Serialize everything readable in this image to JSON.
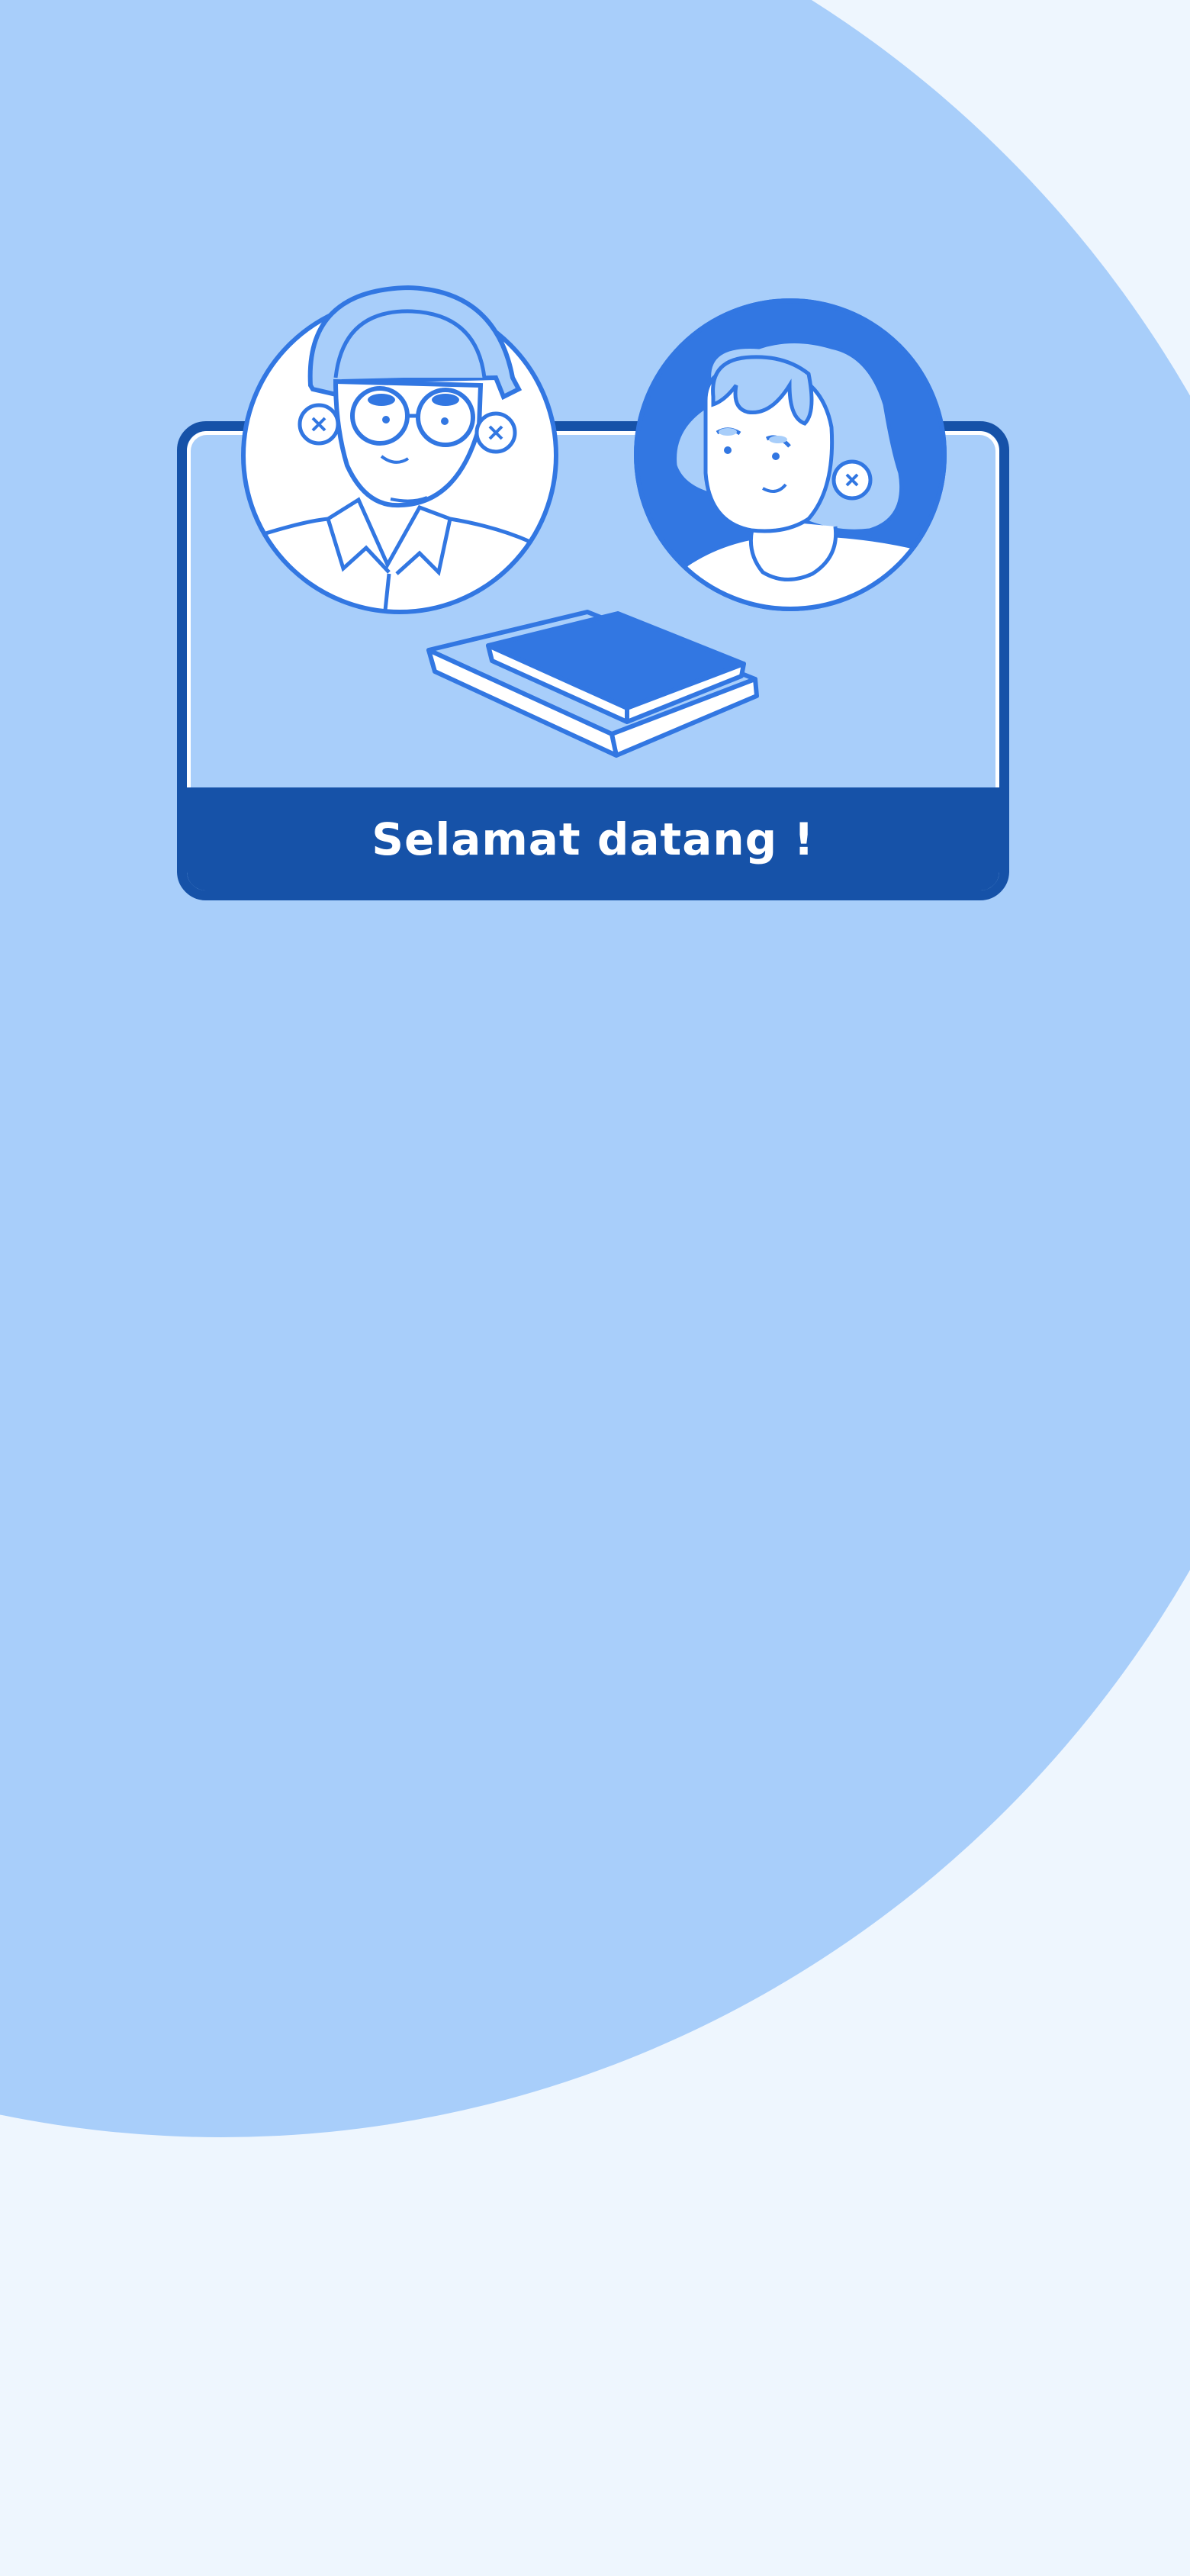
{
  "welcome": {
    "title": "Selamat datang !"
  },
  "colors": {
    "background": "#EEF6FE",
    "circle": "#A8CEFA",
    "card_dark": "#1652A8",
    "accent": "#3277E2",
    "white": "#FFFFFF"
  },
  "illustration": {
    "icons": [
      "student-boy-avatar-icon",
      "student-girl-avatar-icon",
      "books-icon"
    ]
  }
}
